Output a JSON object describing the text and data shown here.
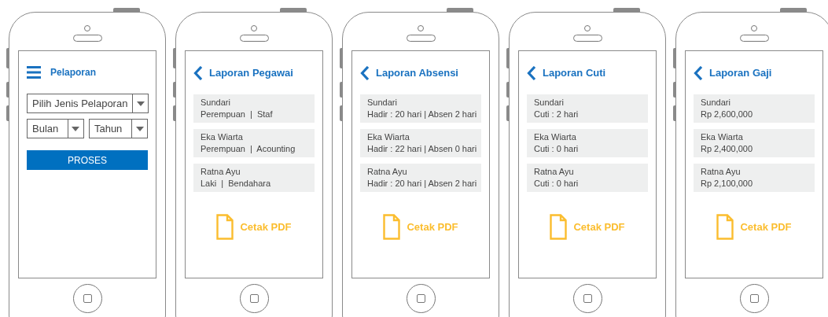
{
  "screens": [
    {
      "kind": "form",
      "title": "Pelaporan",
      "select_rows": [
        [
          "Pilih Jenis Pelaporan"
        ],
        [
          "Bulan",
          "Tahun"
        ]
      ],
      "button": "PROSES"
    },
    {
      "kind": "report",
      "title": "Laporan Pegawai",
      "items": [
        {
          "name": "Sundari",
          "detail": "Perempuan  |  Staf"
        },
        {
          "name": "Eka Wiarta",
          "detail": "Perempuan  |  Acounting"
        },
        {
          "name": "Ratna Ayu",
          "detail": "Laki  |  Bendahara"
        }
      ],
      "print_label": "Cetak PDF"
    },
    {
      "kind": "report",
      "title": "Laporan Absensi",
      "items": [
        {
          "name": "Sundari",
          "detail": "Hadir : 20 hari | Absen 2 hari"
        },
        {
          "name": "Eka Wiarta",
          "detail": "Hadir : 22 hari | Absen 0 hari"
        },
        {
          "name": "Ratna Ayu",
          "detail": "Hadir : 20 hari | Absen 2 hari"
        }
      ],
      "print_label": "Cetak PDF"
    },
    {
      "kind": "report",
      "title": "Laporan Cuti",
      "items": [
        {
          "name": "Sundari",
          "detail": "Cuti : 2 hari"
        },
        {
          "name": "Eka Wiarta",
          "detail": "Cuti : 0 hari"
        },
        {
          "name": "Ratna Ayu",
          "detail": "Cuti : 0 hari"
        }
      ],
      "print_label": "Cetak PDF"
    },
    {
      "kind": "report",
      "title": "Laporan Gaji",
      "items": [
        {
          "name": "Sundari",
          "detail": "Rp 2,600,000"
        },
        {
          "name": "Eka Wiarta",
          "detail": "Rp 2,400,000"
        },
        {
          "name": "Ratna Ayu",
          "detail": "Rp 2,100,000"
        }
      ],
      "print_label": "Cetak PDF"
    }
  ]
}
